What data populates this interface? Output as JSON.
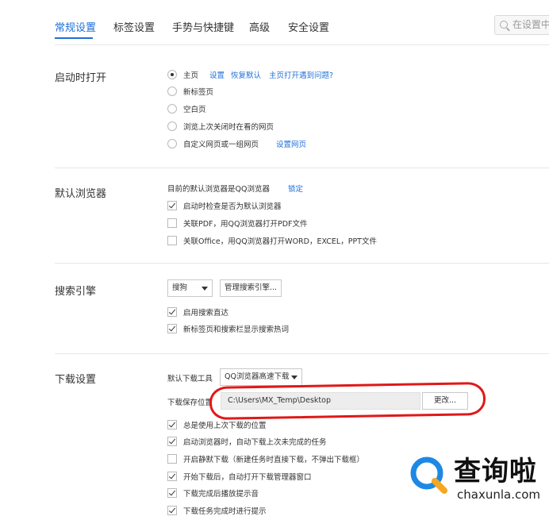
{
  "tabs": [
    {
      "label": "常规设置",
      "active": true
    },
    {
      "label": "标签设置",
      "active": false
    },
    {
      "label": "手势与快捷键",
      "active": false
    },
    {
      "label": "高级",
      "active": false
    },
    {
      "label": "安全设置",
      "active": false
    }
  ],
  "search": {
    "placeholder": "在设置中搜"
  },
  "startup": {
    "title": "启动时打开",
    "options": [
      "主页",
      "新标签页",
      "空白页",
      "浏览上次关闭时在看的网页",
      "自定义网页或一组网页"
    ],
    "selected": "主页",
    "home_links": [
      "设置",
      "恢复默认",
      "主页打开遇到问题?"
    ],
    "custom_link": "设置网页"
  },
  "default_browser": {
    "title": "默认浏览器",
    "status": "目前的默认浏览器是QQ浏览器",
    "lock_link": "锁定",
    "options": [
      {
        "label": "启动时检查是否为默认浏览器",
        "checked": true
      },
      {
        "label": "关联PDF，用QQ浏览器打开PDF文件",
        "checked": false
      },
      {
        "label": "关联Office，用QQ浏览器打开WORD，EXCEL，PPT文件",
        "checked": false
      }
    ]
  },
  "search_engine": {
    "title": "搜索引擎",
    "selected": "搜狗",
    "manage_button": "管理搜索引擎...",
    "options": [
      {
        "label": "启用搜索直达",
        "checked": true
      },
      {
        "label": "新标签页和搜索栏显示搜索热词",
        "checked": true
      }
    ]
  },
  "download": {
    "title": "下载设置",
    "tool_label": "默认下载工具",
    "tool_selected": "QQ浏览器高速下载",
    "path_label": "下载保存位置",
    "path_value": "C:\\Users\\MX_Temp\\Desktop",
    "change_button": "更改...",
    "options": [
      {
        "label": "总是使用上次下载的位置",
        "checked": true
      },
      {
        "label": "启动浏览器时，自动下载上次未完成的任务",
        "checked": true
      },
      {
        "label": "开启静默下载（新建任务时直接下载，不弹出下载框）",
        "checked": false
      },
      {
        "label": "开始下载后，自动打开下载管理器窗口",
        "checked": true
      },
      {
        "label": "下载完成后播放提示音",
        "checked": true
      },
      {
        "label": "下载任务完成时进行提示",
        "checked": true
      }
    ]
  },
  "watermark": {
    "brand": "查询啦",
    "domain": "chaxunla.com"
  },
  "colors": {
    "accent": "#1e6fd9",
    "highlight_ellipse": "#e01818"
  }
}
